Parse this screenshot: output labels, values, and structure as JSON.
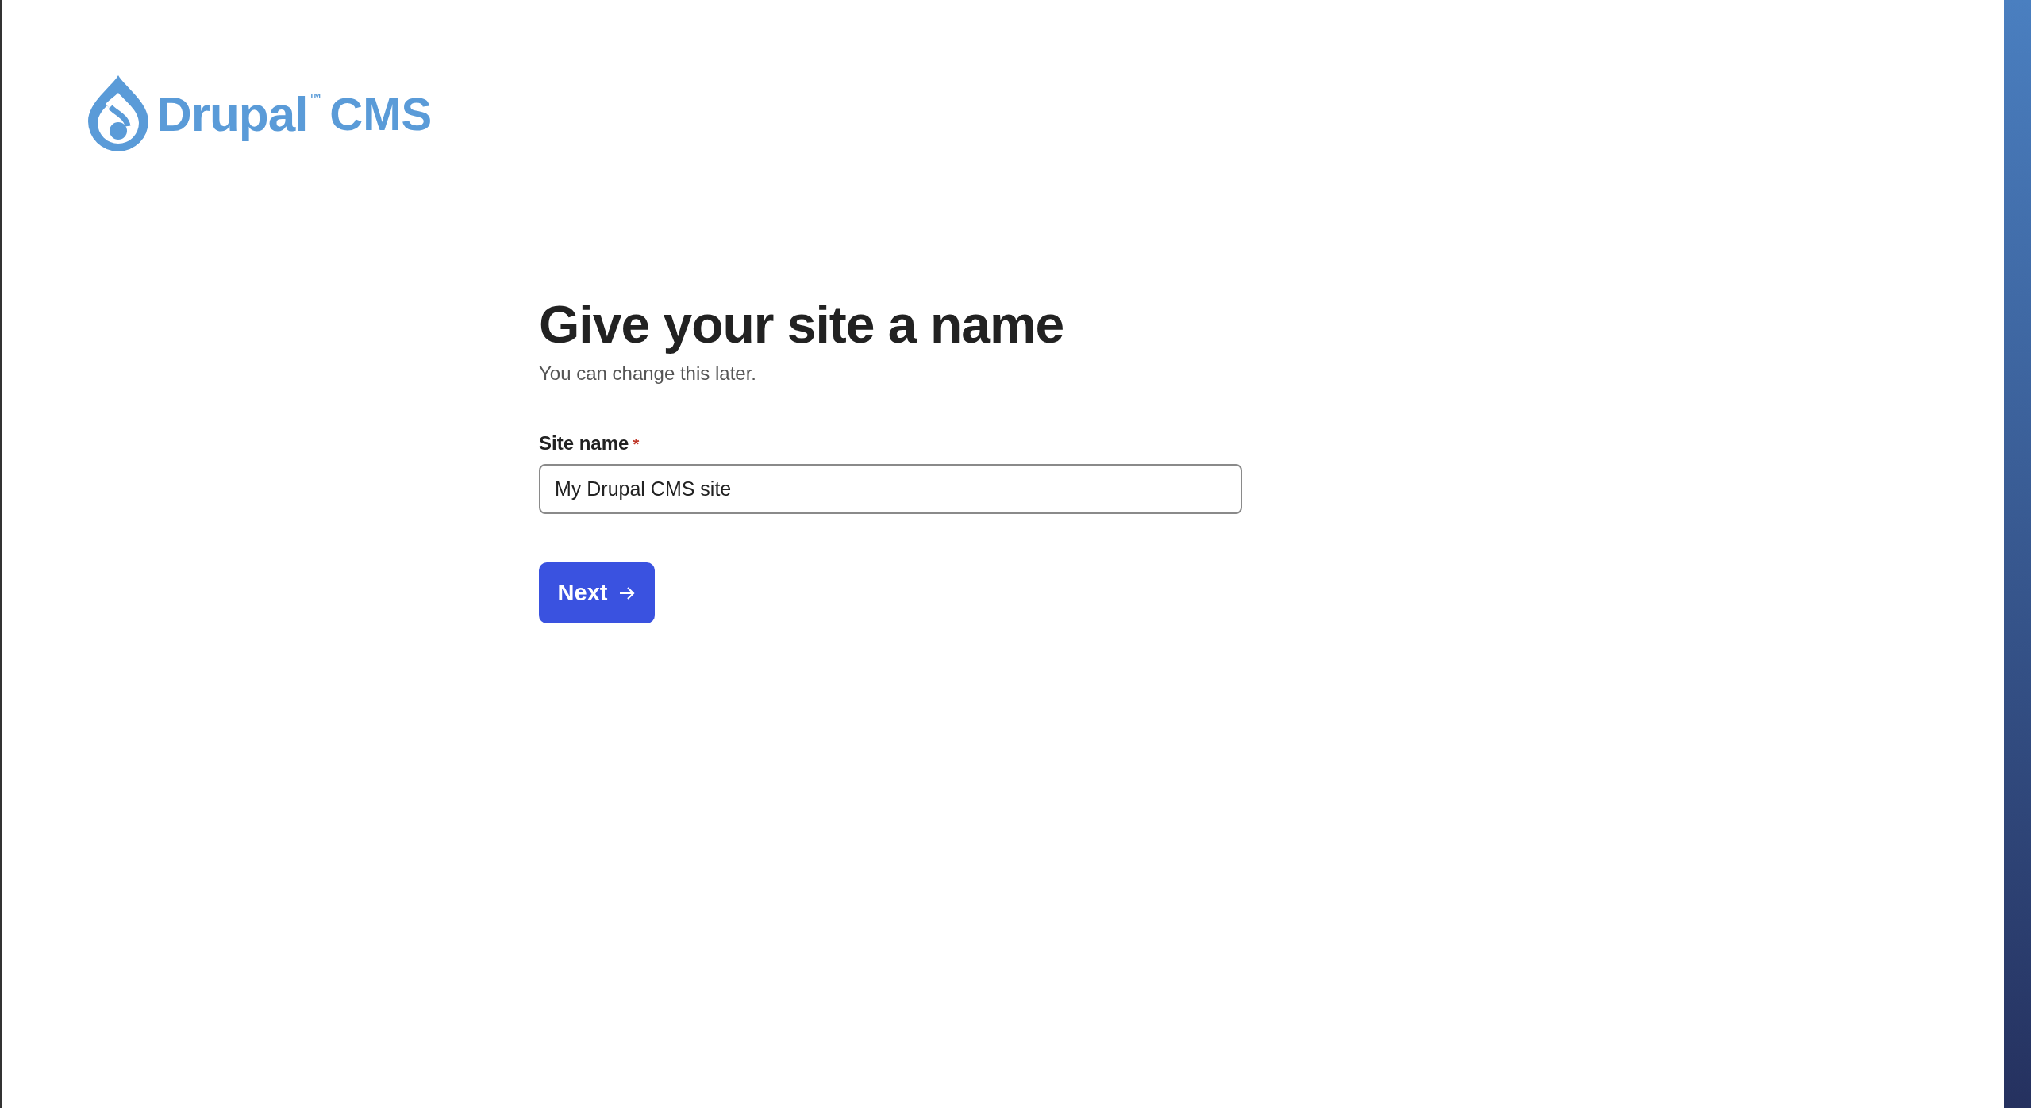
{
  "logo": {
    "name": "Drupal",
    "trademark": "™",
    "product": "CMS"
  },
  "heading": "Give your site a name",
  "subtitle": "You can change this later.",
  "field": {
    "label": "Site name",
    "required": true,
    "required_mark": "*",
    "value": "My Drupal CMS site"
  },
  "button": {
    "label": "Next"
  }
}
